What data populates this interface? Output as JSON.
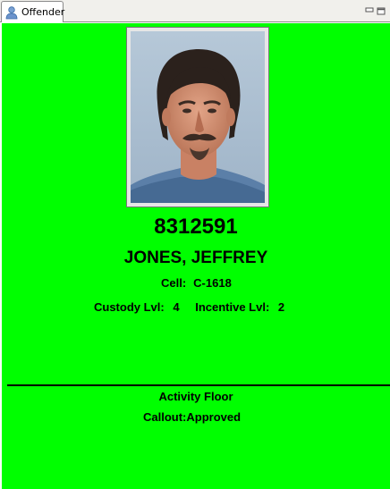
{
  "tab": {
    "label": "Offender",
    "icon": "person-icon"
  },
  "window_controls": [
    "minimize-icon",
    "maximize-icon"
  ],
  "offender": {
    "id": "8312591",
    "name": "JONES, JEFFREY",
    "cell_label": "Cell:",
    "cell_value": "C-1618",
    "custody_label": "Custody Lvl:",
    "custody_value": "4",
    "incentive_label": "Incentive Lvl:",
    "incentive_value": "2",
    "activity": "Activity Floor",
    "callout_label": "Callout:",
    "callout_value": "Approved"
  },
  "colors": {
    "panel_background": "#00ff00",
    "text": "#000000"
  }
}
